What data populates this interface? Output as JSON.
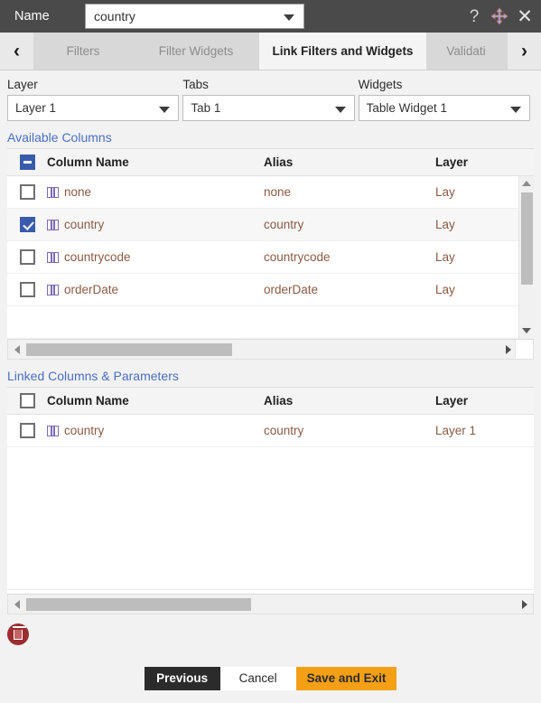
{
  "titlebar": {
    "name_label": "Name",
    "name_value": "country",
    "help_icon": "?",
    "move_icon": "move-icon",
    "close_icon": "✕"
  },
  "tabstrip": {
    "prev_arrow": "‹",
    "next_arrow": "›",
    "tabs": [
      {
        "label": "Filters",
        "active": false
      },
      {
        "label": "Filter Widgets",
        "active": false
      },
      {
        "label": "Link Filters and Widgets",
        "active": true
      },
      {
        "label": "Validati",
        "active": false
      }
    ]
  },
  "selectors": [
    {
      "label": "Layer",
      "value": "Layer 1"
    },
    {
      "label": "Tabs",
      "value": "Tab 1"
    },
    {
      "label": "Widgets",
      "value": "Table Widget 1"
    }
  ],
  "available": {
    "title": "Available Columns",
    "headers": {
      "column_name": "Column Name",
      "alias": "Alias",
      "layer": "Layer"
    },
    "header_checkbox_state": "indeterminate",
    "rows": [
      {
        "checked": false,
        "column_name": "none",
        "alias": "none",
        "layer": "Lay"
      },
      {
        "checked": true,
        "column_name": "country",
        "alias": "country",
        "layer": "Lay"
      },
      {
        "checked": false,
        "column_name": "countrycode",
        "alias": "countrycode",
        "layer": "Lay"
      },
      {
        "checked": false,
        "column_name": "orderDate",
        "alias": "orderDate",
        "layer": "Lay"
      }
    ]
  },
  "linked": {
    "title": "Linked Columns & Parameters",
    "headers": {
      "column_name": "Column Name",
      "alias": "Alias",
      "layer": "Layer"
    },
    "header_checkbox_state": "unchecked",
    "rows": [
      {
        "checked": false,
        "column_name": "country",
        "alias": "country",
        "layer": "Layer 1"
      }
    ]
  },
  "delete_icon": "trash-icon",
  "footer": {
    "previous_label": "Previous",
    "cancel_label": "Cancel",
    "save_label": "Save and Exit"
  },
  "colors": {
    "titlebar_bg": "#4a4a4a",
    "accent_blue": "#3a5bab",
    "section_link": "#4a6fc4",
    "row_text": "#8a5a44",
    "save_button": "#f5a014",
    "previous_button": "#2b2b2b",
    "trash": "#9b2d30"
  }
}
